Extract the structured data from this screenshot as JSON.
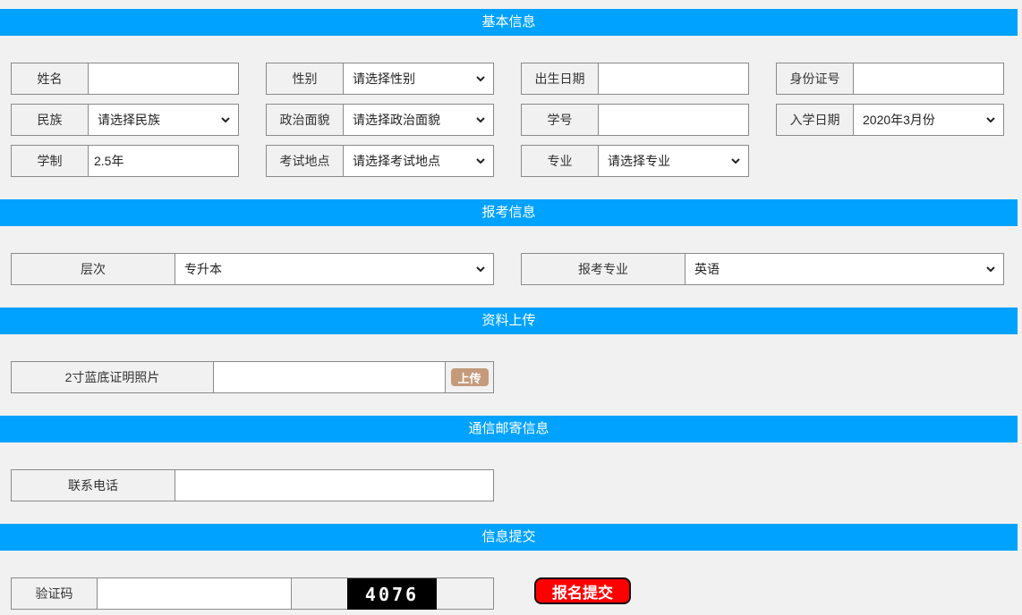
{
  "sections": {
    "basic": "基本信息",
    "exam": "报考信息",
    "upload": "资料上传",
    "mail": "通信邮寄信息",
    "submit": "信息提交"
  },
  "basic": {
    "name_label": "姓名",
    "name_value": "",
    "gender_label": "性别",
    "gender_value": "请选择性别",
    "birth_label": "出生日期",
    "birth_value": "",
    "id_label": "身份证号",
    "id_value": "",
    "ethnic_label": "民族",
    "ethnic_value": "请选择民族",
    "political_label": "政治面貌",
    "political_value": "请选择政治面貌",
    "student_no_label": "学号",
    "student_no_value": "",
    "enroll_label": "入学日期",
    "enroll_value": "2020年3月份",
    "duration_label": "学制",
    "duration_value": "2.5年",
    "location_label": "考试地点",
    "location_value": "请选择考试地点",
    "major_label": "专业",
    "major_value": "请选择专业"
  },
  "exam": {
    "level_label": "层次",
    "level_value": "专升本",
    "major_label": "报考专业",
    "major_value": "英语"
  },
  "upload": {
    "photo_label": "2寸蓝底证明照片",
    "photo_value": "",
    "button_label": "上传"
  },
  "mail": {
    "phone_label": "联系电话",
    "phone_value": ""
  },
  "submit": {
    "captcha_label": "验证码",
    "captcha_value": "",
    "captcha_code": "4076",
    "button_label": "报名提交"
  },
  "colors": {
    "section_bar": "#00a2ff",
    "submit_button": "#ff0000",
    "upload_button": "#c49a7a"
  }
}
